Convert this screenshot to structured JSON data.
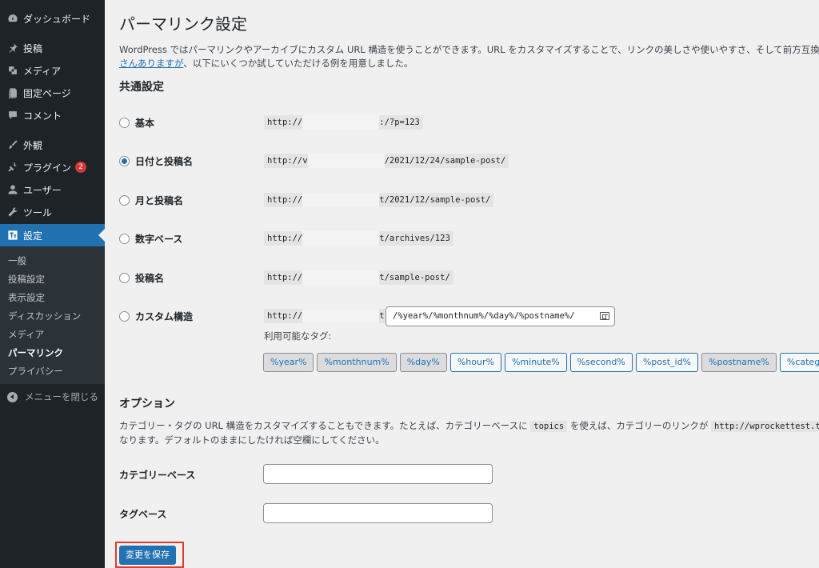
{
  "sidebar": {
    "items": [
      {
        "label": "ダッシュボード",
        "icon": "dashboard-icon"
      },
      {
        "label": "投稿",
        "icon": "pin-icon"
      },
      {
        "label": "メディア",
        "icon": "media-icon"
      },
      {
        "label": "固定ページ",
        "icon": "page-icon"
      },
      {
        "label": "コメント",
        "icon": "comment-icon"
      },
      {
        "label": "外観",
        "icon": "brush-icon"
      },
      {
        "label": "プラグイン",
        "icon": "plugin-icon",
        "badge": "2"
      },
      {
        "label": "ユーザー",
        "icon": "user-icon"
      },
      {
        "label": "ツール",
        "icon": "wrench-icon"
      },
      {
        "label": "設定",
        "icon": "settings-icon"
      }
    ],
    "submenu": [
      "一般",
      "投稿設定",
      "表示設定",
      "ディスカッション",
      "メディア",
      "パーマリンク",
      "プライバシー"
    ],
    "collapse_label": "メニューを閉じる"
  },
  "main": {
    "title": "パーマリンク設定",
    "intro_prefix": "WordPress ではパーマリンクやアーカイブにカスタム URL 構造を使うことができます。URL をカスタマイズすることで、リンクの美しさや使いやすさ、そして前方互換性を改善できる",
    "intro_link": "さんありますが",
    "intro_suffix": "、以下にいくつか試していただける例を用意しました。",
    "common_heading": "共通設定",
    "options": [
      {
        "label": "基本",
        "prefix": "http://",
        "suffix": ":/?p=123",
        "checked": false
      },
      {
        "label": "日付と投稿名",
        "prefix": "http://v",
        "suffix": "/2021/12/24/sample-post/",
        "checked": true
      },
      {
        "label": "月と投稿名",
        "prefix": "http://",
        "suffix": "t/2021/12/sample-post/",
        "checked": false
      },
      {
        "label": "数字ベース",
        "prefix": "http://",
        "suffix": "t/archives/123",
        "checked": false
      },
      {
        "label": "投稿名",
        "prefix": "http://",
        "suffix": "t/sample-post/",
        "checked": false
      },
      {
        "label": "カスタム構造",
        "prefix": "http://",
        "suffix": "t",
        "checked": false
      }
    ],
    "custom_structure_value": "/%year%/%monthnum%/%day%/%postname%/",
    "tags_label": "利用可能なタグ:",
    "tags": [
      {
        "label": "%year%",
        "active": true
      },
      {
        "label": "%monthnum%",
        "active": true
      },
      {
        "label": "%day%",
        "active": true
      },
      {
        "label": "%hour%",
        "active": false
      },
      {
        "label": "%minute%",
        "active": false
      },
      {
        "label": "%second%",
        "active": false
      },
      {
        "label": "%post_id%",
        "active": false
      },
      {
        "label": "%postname%",
        "active": true
      },
      {
        "label": "%category%",
        "active": false
      }
    ],
    "options_heading": "オプション",
    "options_desc_1": "カテゴリー・タグの URL 構造をカスタマイズすることもできます。たとえば、カテゴリーベースに ",
    "options_desc_code1": "topics",
    "options_desc_2": " を使えば、カテゴリーのリンクが ",
    "options_desc_code2": "http://wprockettest.test/topics/",
    "options_desc_line2": "なります。デフォルトのままにしたければ空欄にしてください。",
    "category_base_label": "カテゴリーベース",
    "tag_base_label": "タグベース",
    "category_base_value": "",
    "tag_base_value": "",
    "save_label": "変更を保存"
  },
  "colors": {
    "accent": "#2271b1",
    "sidebar_bg": "#1d2327",
    "highlight_frame": "#e03b2b"
  }
}
